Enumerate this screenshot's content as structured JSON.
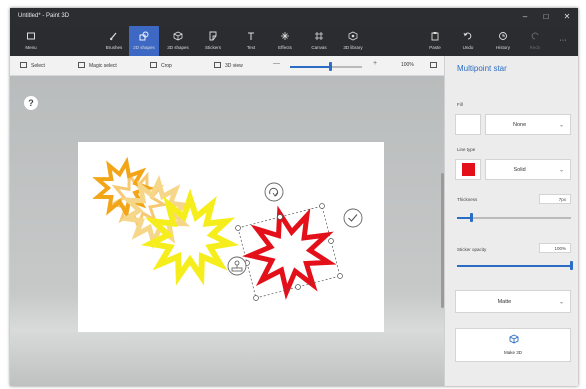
{
  "window": {
    "title": "Untitled* - Paint 3D",
    "controls": [
      "–",
      "□",
      "✕"
    ]
  },
  "toolbar": {
    "menu": {
      "label": "Menu",
      "icon": "menu-icon"
    },
    "brushes": {
      "label": "Brushes",
      "icon": "brush-icon"
    },
    "shapes2d": {
      "label": "2D shapes",
      "icon": "2d-shapes-icon"
    },
    "shapes3d": {
      "label": "3D shapes",
      "icon": "3d-shapes-icon"
    },
    "stickers": {
      "label": "Stickers",
      "icon": "sticker-icon"
    },
    "text": {
      "label": "Text",
      "icon": "text-icon"
    },
    "effects": {
      "label": "Effects",
      "icon": "effects-icon"
    },
    "canvas": {
      "label": "Canvas",
      "icon": "canvas-icon"
    },
    "library": {
      "label": "3D library",
      "icon": "library-icon"
    },
    "paste": {
      "label": "Paste",
      "icon": "paste-icon"
    },
    "undo": {
      "label": "Undo",
      "icon": "undo-icon"
    },
    "history": {
      "label": "History",
      "icon": "history-icon"
    },
    "redo": {
      "label": "Redo",
      "icon": "redo-icon"
    },
    "more": {
      "label": "···"
    }
  },
  "subbar": {
    "select": "Select",
    "magic_select": "Magic select",
    "crop": "Crop",
    "view3d": "3D view",
    "zoom_minus": "—",
    "zoom_plus": "+",
    "zoom": "100%",
    "zoom_level": 0.55
  },
  "canvas": {
    "help": "?",
    "colors": {
      "orange": "#f2a516",
      "pale": "#f6d78a",
      "yellow": "#f6ee1c",
      "red": "#e3101a"
    }
  },
  "panel": {
    "title": "Multipoint star",
    "fill_label": "Fill",
    "fill_value": "None",
    "line_type_label": "Line type",
    "line_type_value": "Solid",
    "line_color": "#e3101a",
    "thickness_label": "Thickness",
    "thickness_value": "7px",
    "thickness_level": 0.12,
    "opacity_label": "Sticker opacity",
    "opacity_value": "100%",
    "opacity_level": 1.0,
    "finish_value": "Matte",
    "make3d_label": "Make 3D",
    "accent": "#2b6cc4"
  }
}
